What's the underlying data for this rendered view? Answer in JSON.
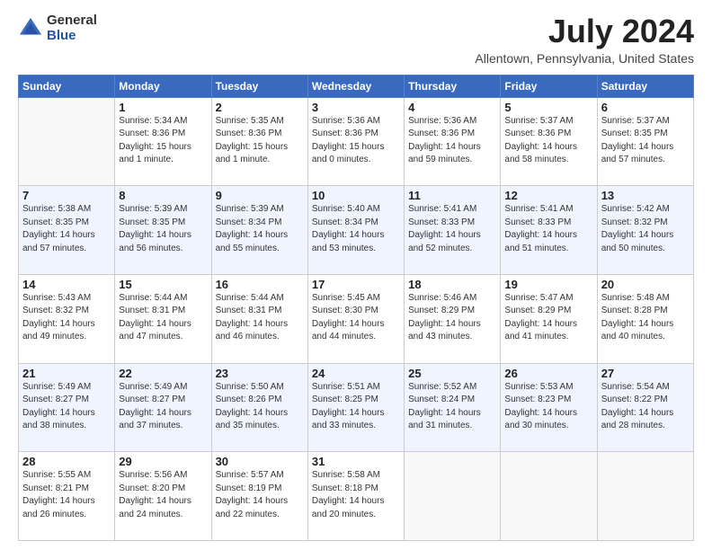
{
  "logo": {
    "general": "General",
    "blue": "Blue"
  },
  "title": "July 2024",
  "location": "Allentown, Pennsylvania, United States",
  "days_of_week": [
    "Sunday",
    "Monday",
    "Tuesday",
    "Wednesday",
    "Thursday",
    "Friday",
    "Saturday"
  ],
  "weeks": [
    [
      {
        "day": "",
        "info": ""
      },
      {
        "day": "1",
        "info": "Sunrise: 5:34 AM\nSunset: 8:36 PM\nDaylight: 15 hours\nand 1 minute."
      },
      {
        "day": "2",
        "info": "Sunrise: 5:35 AM\nSunset: 8:36 PM\nDaylight: 15 hours\nand 1 minute."
      },
      {
        "day": "3",
        "info": "Sunrise: 5:36 AM\nSunset: 8:36 PM\nDaylight: 15 hours\nand 0 minutes."
      },
      {
        "day": "4",
        "info": "Sunrise: 5:36 AM\nSunset: 8:36 PM\nDaylight: 14 hours\nand 59 minutes."
      },
      {
        "day": "5",
        "info": "Sunrise: 5:37 AM\nSunset: 8:36 PM\nDaylight: 14 hours\nand 58 minutes."
      },
      {
        "day": "6",
        "info": "Sunrise: 5:37 AM\nSunset: 8:35 PM\nDaylight: 14 hours\nand 57 minutes."
      }
    ],
    [
      {
        "day": "7",
        "info": "Sunrise: 5:38 AM\nSunset: 8:35 PM\nDaylight: 14 hours\nand 57 minutes."
      },
      {
        "day": "8",
        "info": "Sunrise: 5:39 AM\nSunset: 8:35 PM\nDaylight: 14 hours\nand 56 minutes."
      },
      {
        "day": "9",
        "info": "Sunrise: 5:39 AM\nSunset: 8:34 PM\nDaylight: 14 hours\nand 55 minutes."
      },
      {
        "day": "10",
        "info": "Sunrise: 5:40 AM\nSunset: 8:34 PM\nDaylight: 14 hours\nand 53 minutes."
      },
      {
        "day": "11",
        "info": "Sunrise: 5:41 AM\nSunset: 8:33 PM\nDaylight: 14 hours\nand 52 minutes."
      },
      {
        "day": "12",
        "info": "Sunrise: 5:41 AM\nSunset: 8:33 PM\nDaylight: 14 hours\nand 51 minutes."
      },
      {
        "day": "13",
        "info": "Sunrise: 5:42 AM\nSunset: 8:32 PM\nDaylight: 14 hours\nand 50 minutes."
      }
    ],
    [
      {
        "day": "14",
        "info": "Sunrise: 5:43 AM\nSunset: 8:32 PM\nDaylight: 14 hours\nand 49 minutes."
      },
      {
        "day": "15",
        "info": "Sunrise: 5:44 AM\nSunset: 8:31 PM\nDaylight: 14 hours\nand 47 minutes."
      },
      {
        "day": "16",
        "info": "Sunrise: 5:44 AM\nSunset: 8:31 PM\nDaylight: 14 hours\nand 46 minutes."
      },
      {
        "day": "17",
        "info": "Sunrise: 5:45 AM\nSunset: 8:30 PM\nDaylight: 14 hours\nand 44 minutes."
      },
      {
        "day": "18",
        "info": "Sunrise: 5:46 AM\nSunset: 8:29 PM\nDaylight: 14 hours\nand 43 minutes."
      },
      {
        "day": "19",
        "info": "Sunrise: 5:47 AM\nSunset: 8:29 PM\nDaylight: 14 hours\nand 41 minutes."
      },
      {
        "day": "20",
        "info": "Sunrise: 5:48 AM\nSunset: 8:28 PM\nDaylight: 14 hours\nand 40 minutes."
      }
    ],
    [
      {
        "day": "21",
        "info": "Sunrise: 5:49 AM\nSunset: 8:27 PM\nDaylight: 14 hours\nand 38 minutes."
      },
      {
        "day": "22",
        "info": "Sunrise: 5:49 AM\nSunset: 8:27 PM\nDaylight: 14 hours\nand 37 minutes."
      },
      {
        "day": "23",
        "info": "Sunrise: 5:50 AM\nSunset: 8:26 PM\nDaylight: 14 hours\nand 35 minutes."
      },
      {
        "day": "24",
        "info": "Sunrise: 5:51 AM\nSunset: 8:25 PM\nDaylight: 14 hours\nand 33 minutes."
      },
      {
        "day": "25",
        "info": "Sunrise: 5:52 AM\nSunset: 8:24 PM\nDaylight: 14 hours\nand 31 minutes."
      },
      {
        "day": "26",
        "info": "Sunrise: 5:53 AM\nSunset: 8:23 PM\nDaylight: 14 hours\nand 30 minutes."
      },
      {
        "day": "27",
        "info": "Sunrise: 5:54 AM\nSunset: 8:22 PM\nDaylight: 14 hours\nand 28 minutes."
      }
    ],
    [
      {
        "day": "28",
        "info": "Sunrise: 5:55 AM\nSunset: 8:21 PM\nDaylight: 14 hours\nand 26 minutes."
      },
      {
        "day": "29",
        "info": "Sunrise: 5:56 AM\nSunset: 8:20 PM\nDaylight: 14 hours\nand 24 minutes."
      },
      {
        "day": "30",
        "info": "Sunrise: 5:57 AM\nSunset: 8:19 PM\nDaylight: 14 hours\nand 22 minutes."
      },
      {
        "day": "31",
        "info": "Sunrise: 5:58 AM\nSunset: 8:18 PM\nDaylight: 14 hours\nand 20 minutes."
      },
      {
        "day": "",
        "info": ""
      },
      {
        "day": "",
        "info": ""
      },
      {
        "day": "",
        "info": ""
      }
    ]
  ]
}
